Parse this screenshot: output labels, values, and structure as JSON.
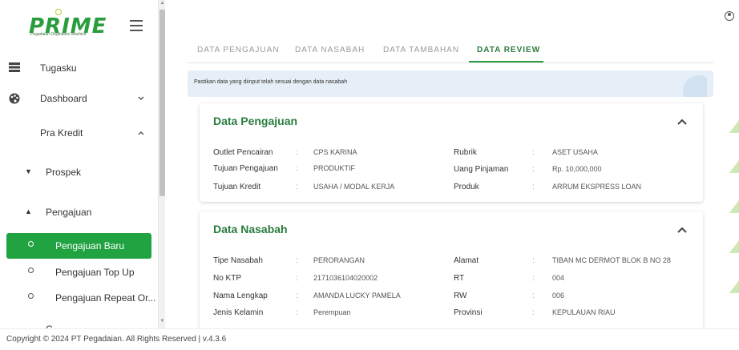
{
  "brand": {
    "name": "PRIME",
    "tagline": "Pegadaian Origination Machine"
  },
  "sidebar": {
    "items": [
      {
        "label": "Tugasku",
        "icon": "tasks-icon"
      },
      {
        "label": "Dashboard",
        "icon": "palette-icon",
        "chevron": "expand"
      },
      {
        "label": "Pra Kredit",
        "chevron": "collapse"
      }
    ],
    "sub": [
      {
        "label": "Prospek",
        "expanded": false
      },
      {
        "label": "Pengajuan",
        "expanded": true
      }
    ],
    "leaves": [
      {
        "label": "Pengajuan Baru",
        "active": true
      },
      {
        "label": "Pengajuan Top Up",
        "active": false
      },
      {
        "label": "Pengajuan Repeat Or...",
        "active": false
      }
    ],
    "partial_next": "C"
  },
  "tabs": [
    {
      "label": "DATA PENGAJUAN",
      "active": false
    },
    {
      "label": "DATA NASABAH",
      "active": false
    },
    {
      "label": "DATA TAMBAHAN",
      "active": false
    },
    {
      "label": "DATA REVIEW",
      "active": true
    }
  ],
  "info_banner": "Pastikan data yang diinput telah sesuai dengan data nasabah",
  "cards": {
    "pengajuan": {
      "title": "Data Pengajuan",
      "left": [
        {
          "label": "Outlet Pencairan",
          "value": "CPS KARINA"
        },
        {
          "label": "Tujuan Pengajuan",
          "value": "PRODUKTIF"
        },
        {
          "label": "Tujuan Kredit",
          "value": "USAHA / MODAL KERJA"
        }
      ],
      "right": [
        {
          "label": "Rubrik",
          "value": "ASET USAHA"
        },
        {
          "label": "Uang Pinjaman",
          "value": "Rp. 10,000,000"
        },
        {
          "label": "Produk",
          "value": "ARRUM EKSPRESS LOAN"
        }
      ]
    },
    "nasabah": {
      "title": "Data Nasabah",
      "left": [
        {
          "label": "Tipe Nasabah",
          "value": "PERORANGAN"
        },
        {
          "label": "No KTP",
          "value": "2171036104020002"
        },
        {
          "label": "Nama Lengkap",
          "value": "AMANDA LUCKY PAMELA"
        },
        {
          "label": "Jenis Kelamin",
          "value": "Perempuan"
        }
      ],
      "right": [
        {
          "label": "Alamat",
          "value": "TIBAN MC DERMOT BLOK B NO 28"
        },
        {
          "label": "RT",
          "value": "004"
        },
        {
          "label": "RW",
          "value": "006"
        },
        {
          "label": "Provinsi",
          "value": "KEPULAUAN RIAU"
        }
      ]
    }
  },
  "separator": ":",
  "footer": "Copyright © 2024 PT Pegadaian. All Rights Reserved | v.4.3.6",
  "colors": {
    "brand_green": "#21a341",
    "heading_green": "#2a7c3d",
    "info_bg": "#e6eff8"
  }
}
